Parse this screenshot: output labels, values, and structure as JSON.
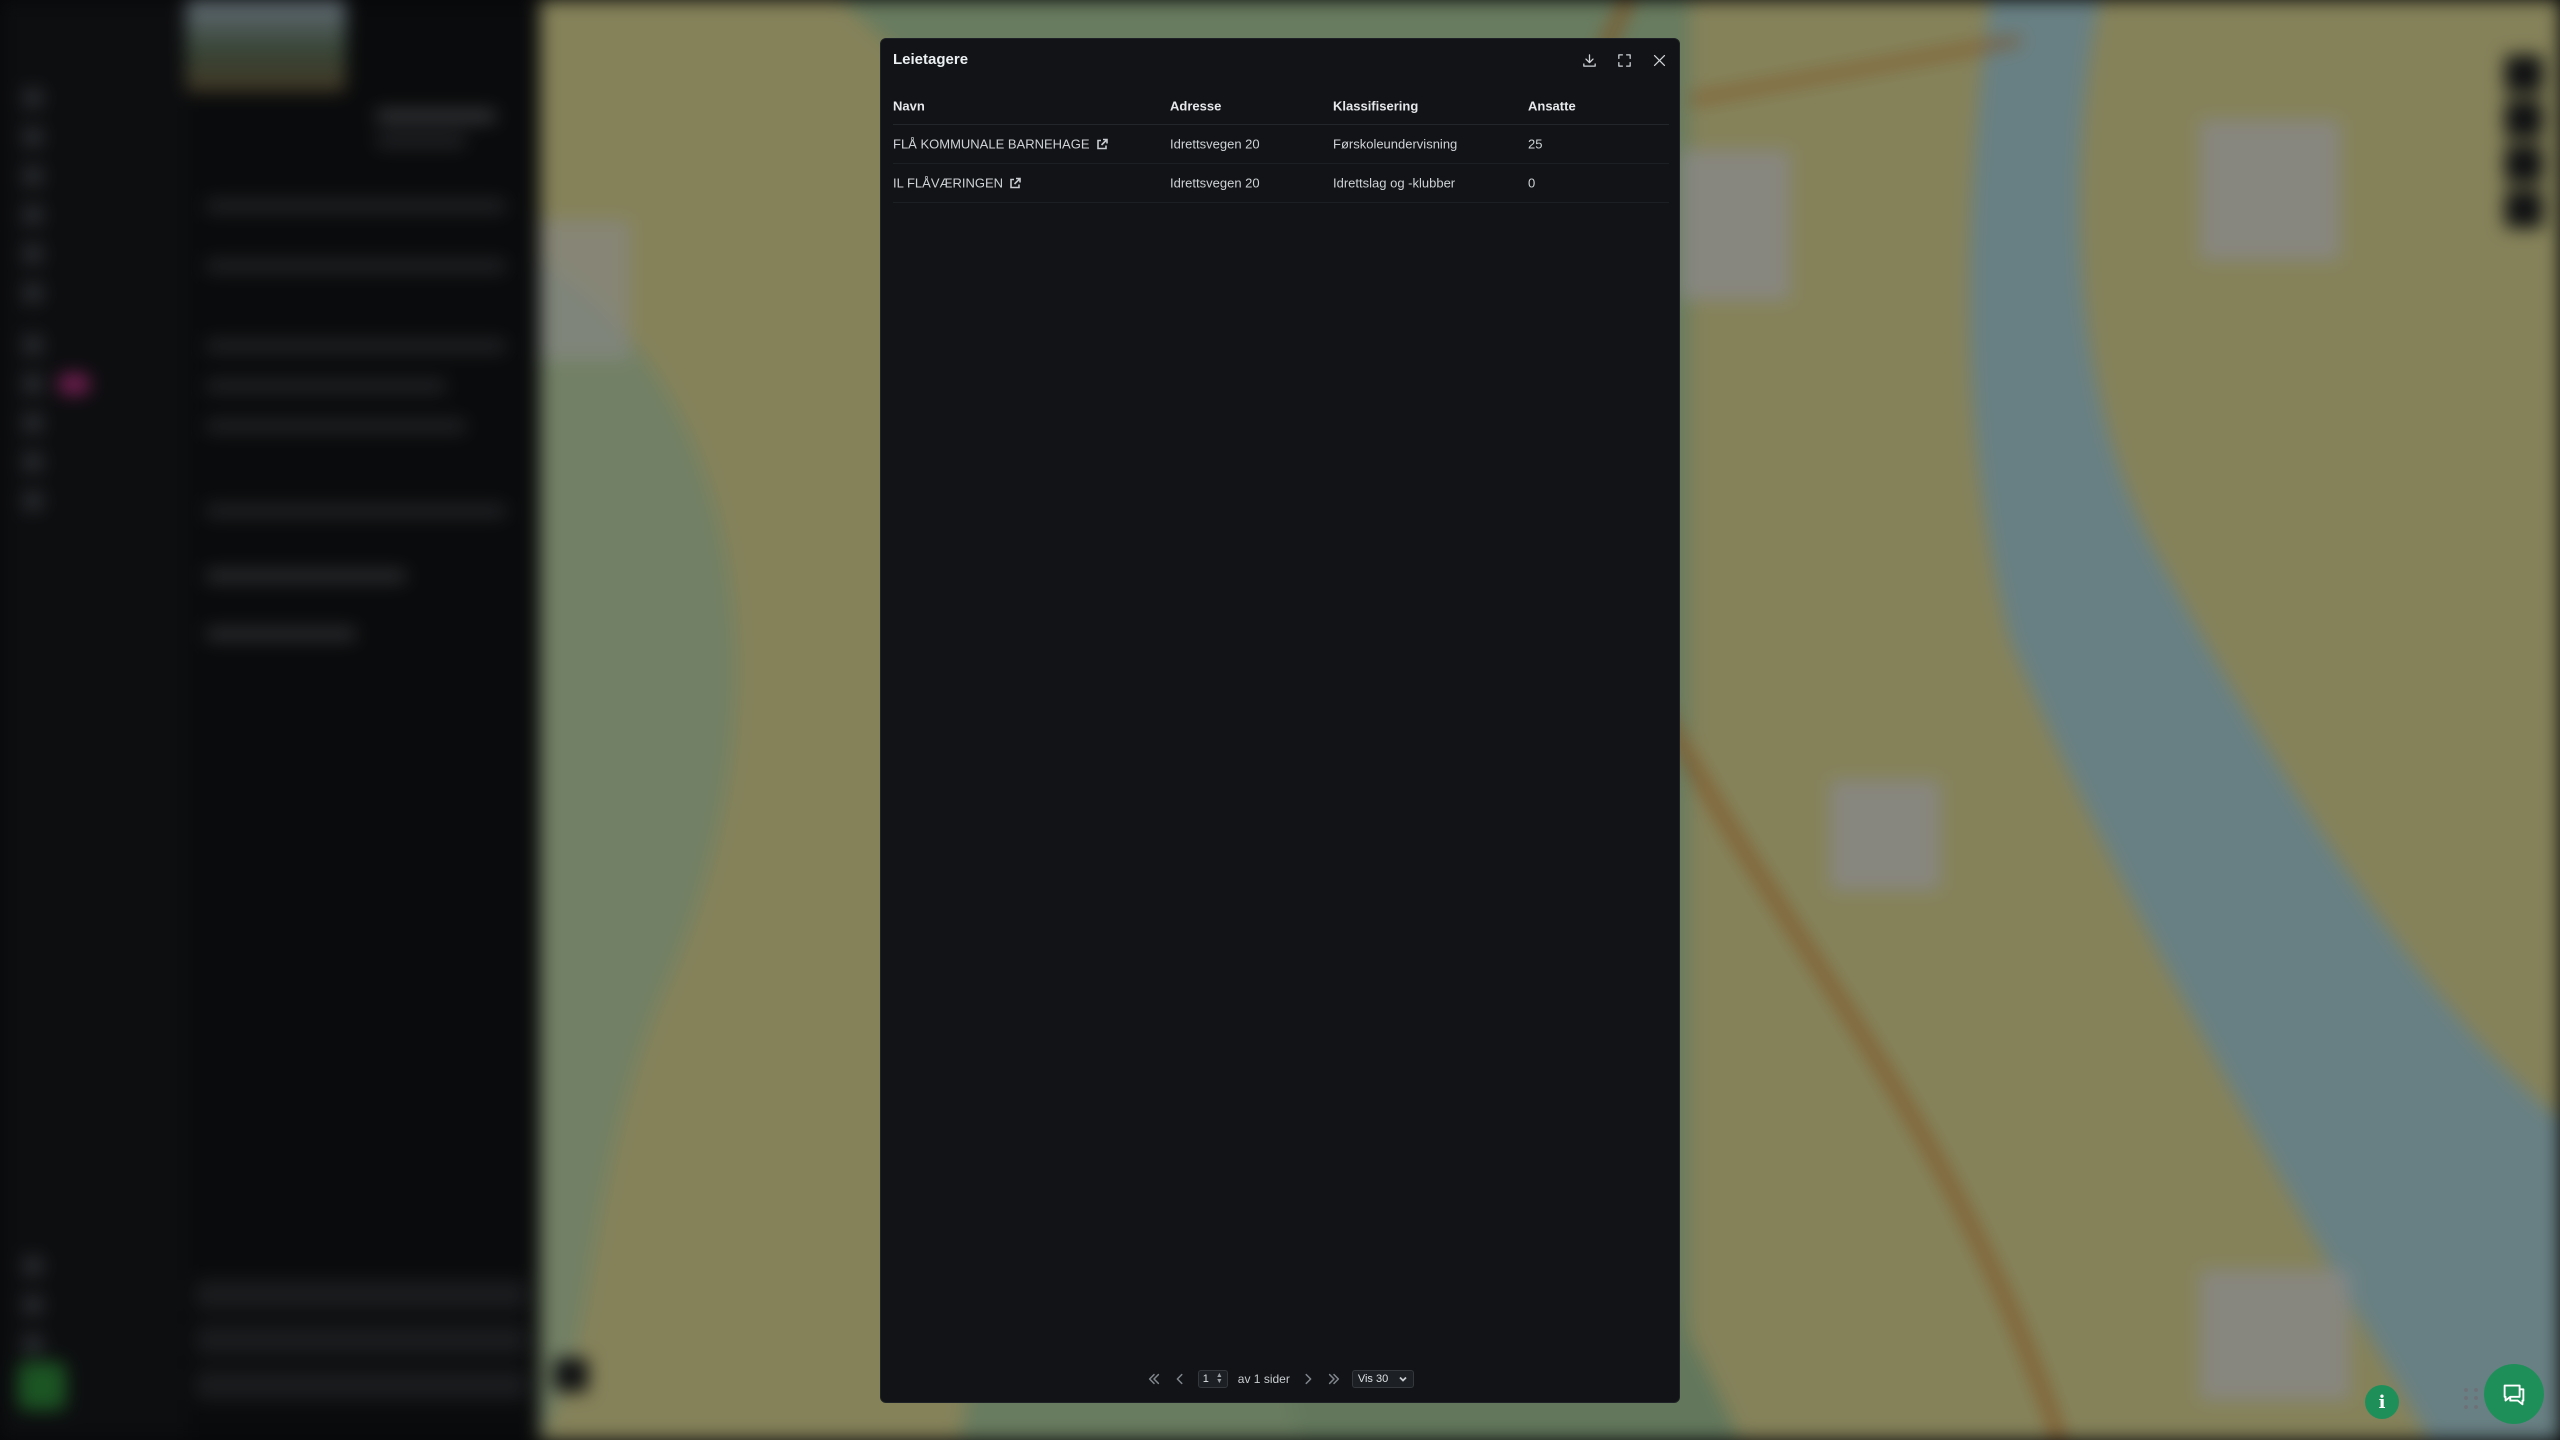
{
  "modal": {
    "title": "Leietagere",
    "columns": [
      "Navn",
      "Adresse",
      "Klassifisering",
      "Ansatte"
    ],
    "rows": [
      {
        "navn": "FLÅ KOMMUNALE BARNEHAGE",
        "adresse": "Idrettsvegen 20",
        "klassifisering": "Førskoleundervisning",
        "ansatte": "25"
      },
      {
        "navn": "IL FLÅVÆRINGEN",
        "adresse": "Idrettsvegen 20",
        "klassifisering": "Idrettslag og -klubber",
        "ansatte": "0"
      }
    ],
    "pager": {
      "current_page": "1",
      "of_pages_text": "av 1 sider",
      "page_size_label": "Vis 30"
    }
  },
  "icons": {
    "download": "download-icon",
    "fullscreen": "expand-icon",
    "close": "close-icon",
    "external": "external-link-icon",
    "first": "chevrons-left-icon",
    "prev": "chevron-left-icon",
    "next": "chevron-right-icon",
    "last": "chevrons-right-icon",
    "info": "info-icon",
    "chat": "chat-icon"
  },
  "colors": {
    "modal_bg": "#111316",
    "accent_green": "#1f8f5a",
    "nav_badge": "#c2348a"
  }
}
